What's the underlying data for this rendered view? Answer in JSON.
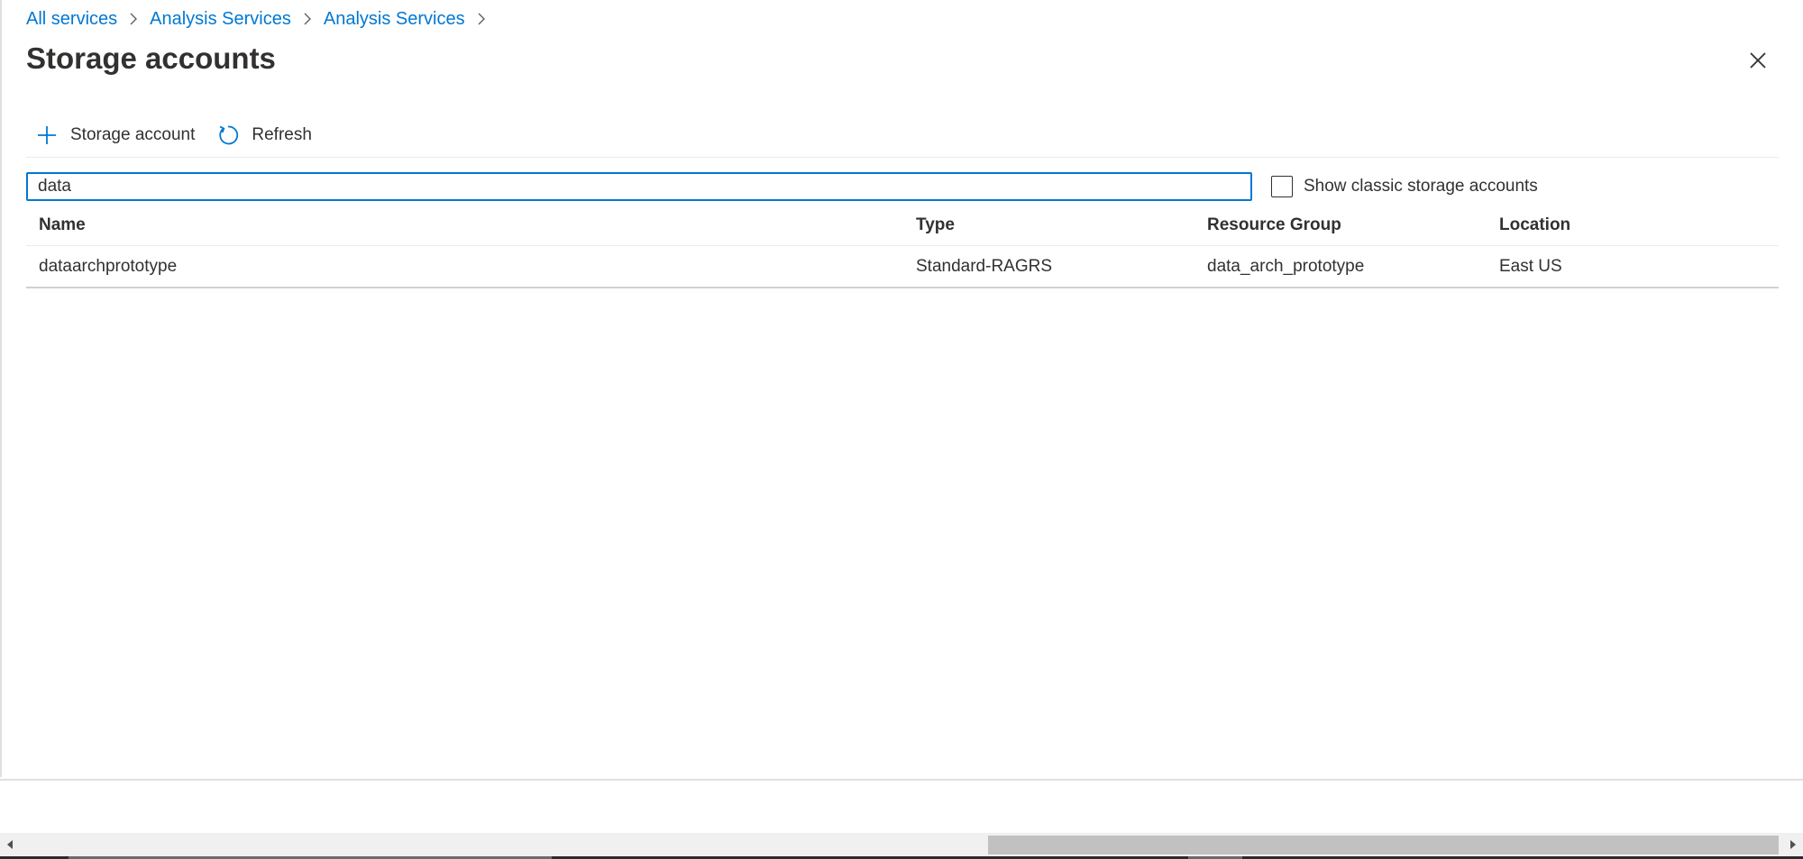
{
  "breadcrumb": {
    "items": [
      {
        "label": "All services"
      },
      {
        "label": "Analysis Services"
      },
      {
        "label": "Analysis Services"
      }
    ]
  },
  "page": {
    "title": "Storage accounts"
  },
  "toolbar": {
    "add_label": "Storage account",
    "refresh_label": "Refresh"
  },
  "filter": {
    "value": "data",
    "show_classic_label": "Show classic storage accounts",
    "show_classic_checked": false
  },
  "table": {
    "columns": [
      "Name",
      "Type",
      "Resource Group",
      "Location"
    ],
    "rows": [
      [
        "dataarchprototype",
        "Standard-RAGRS",
        "data_arch_prototype",
        "East US"
      ]
    ]
  },
  "colors": {
    "accent": "#0078d4",
    "text": "#323130",
    "divider": "#edebe9"
  },
  "icons": {
    "add": "plus-icon",
    "refresh": "refresh-icon",
    "close": "close-icon",
    "separator": "chevron-right-icon"
  }
}
